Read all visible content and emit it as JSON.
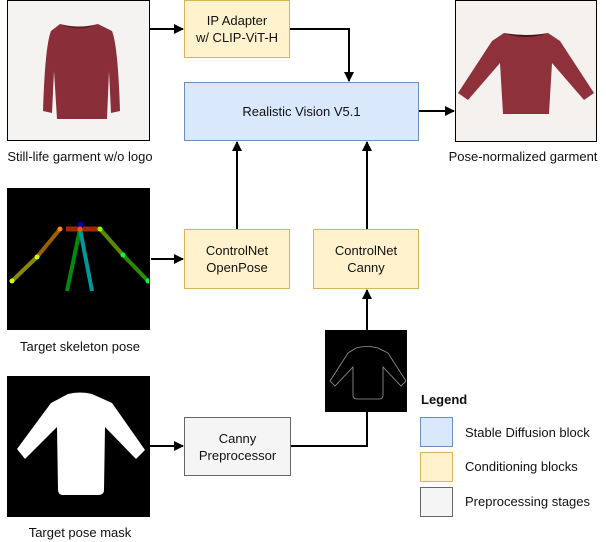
{
  "images": {
    "still_life": {
      "caption": "Still-life garment w/o logo",
      "garment_color": "#8a2f3a",
      "background": "#f4f3f1"
    },
    "pose_normalized": {
      "caption": "Pose-normalized garment",
      "garment_color": "#8e313b",
      "background": "#f4f1ee"
    },
    "skeleton": {
      "caption": "Target skeleton pose"
    },
    "pose_mask": {
      "caption": "Target pose mask"
    },
    "canny_edges": {
      "caption": ""
    }
  },
  "blocks": {
    "ip_adapter": {
      "line1": "IP Adapter",
      "line2": "w/ CLIP-ViT-H"
    },
    "realistic_vision": {
      "label": "Realistic Vision V5.1"
    },
    "controlnet_openpose": {
      "line1": "ControlNet",
      "line2": "OpenPose"
    },
    "controlnet_canny": {
      "line1": "ControlNet",
      "line2": "Canny"
    },
    "canny_preprocessor": {
      "line1": "Canny",
      "line2": "Preprocessor"
    }
  },
  "legend": {
    "title": "Legend",
    "items": [
      {
        "label": "Stable Diffusion block",
        "fill": "#dae8fc",
        "stroke": "#6c8ebf"
      },
      {
        "label": "Conditioning blocks",
        "fill": "#fff2cc",
        "stroke": "#d6b656"
      },
      {
        "label": "Preprocessing stages",
        "fill": "#f5f5f5",
        "stroke": "#666666"
      }
    ]
  }
}
